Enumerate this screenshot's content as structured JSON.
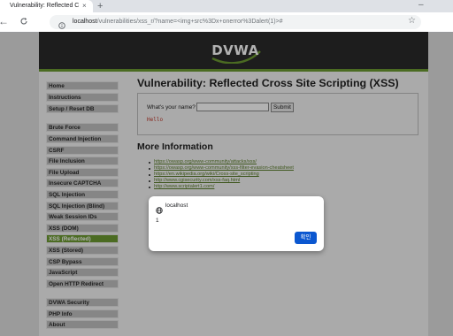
{
  "browser": {
    "tab_title": "Vulnerability: Reflected Cross",
    "tab_close": "×",
    "new_tab": "+",
    "window_minimize": "–",
    "back": "←",
    "reload": "C",
    "url_host": "localhost",
    "url_path": "/vulnerabilities/xss_r/?name=<img+src%3Dx+onerror%3Dalert(1)>#",
    "bookmark_star": "☆"
  },
  "logo": {
    "text": "DVWA"
  },
  "menu": {
    "items": [
      {
        "label": "Home"
      },
      {
        "label": "Instructions"
      },
      {
        "label": "Setup / Reset DB"
      },
      {
        "label": "Brute Force"
      },
      {
        "label": "Command Injection"
      },
      {
        "label": "CSRF"
      },
      {
        "label": "File Inclusion"
      },
      {
        "label": "File Upload"
      },
      {
        "label": "Insecure CAPTCHA"
      },
      {
        "label": "SQL Injection"
      },
      {
        "label": "SQL Injection (Blind)"
      },
      {
        "label": "Weak Session IDs"
      },
      {
        "label": "XSS (DOM)"
      },
      {
        "label": "XSS (Reflected)"
      },
      {
        "label": "XSS (Stored)"
      },
      {
        "label": "CSP Bypass"
      },
      {
        "label": "JavaScript"
      },
      {
        "label": "Open HTTP Redirect"
      },
      {
        "label": "DVWA Security"
      },
      {
        "label": "PHP Info"
      },
      {
        "label": "About"
      }
    ],
    "selected": "XSS (Reflected)"
  },
  "main": {
    "title": "Vulnerability: Reflected Cross Site Scripting (XSS)",
    "form_label": "What's your name?",
    "input_value": "",
    "submit_label": "Submit",
    "output_text": "Hello",
    "more_info_title": "More Information",
    "links": [
      "https://owasp.org/www-community/attacks/xss/",
      "https://owasp.org/www-community/xss-filter-evasion-cheatsheet",
      "https://en.wikipedia.org/wiki/Cross-site_scripting",
      "http://www.cgisecurity.com/xss-faq.html",
      "http://www.scriptalert1.com/"
    ]
  },
  "dialog": {
    "origin": "localhost",
    "message": "1",
    "ok_label": "확인"
  },
  "colors": {
    "accent_green": "#6c9a31",
    "dialog_button": "#0b57d0",
    "header_dark": "#2a2a2a",
    "link_green": "#5a7d2a"
  }
}
